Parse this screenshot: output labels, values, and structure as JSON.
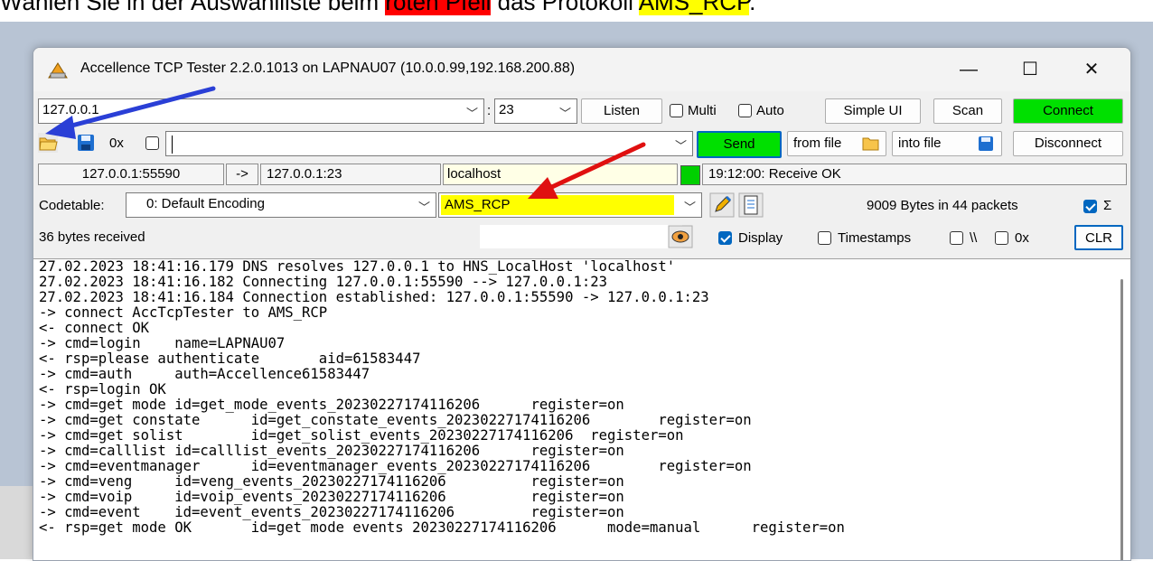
{
  "doc": {
    "prefix": "Wählen Sie in der Auswahlliste beim ",
    "highlight_red": "roten Pfeil",
    "middle": " das Protokoll ",
    "highlight_yellow": "AMS_RCP",
    "suffix": "."
  },
  "window": {
    "title": "Accellence TCP Tester 2.2.0.1013 on LAPNAU07 (10.0.0.99,192.168.200.88)",
    "minimize": "—",
    "maximize": "☐",
    "close": "✕"
  },
  "connection": {
    "host": "127.0.0.1",
    "port": "23",
    "listen": "Listen",
    "multi": "Multi",
    "multi_checked": false,
    "auto": "Auto",
    "auto_checked": false,
    "simple_ui": "Simple UI",
    "scan": "Scan",
    "connect": "Connect",
    "connect_color": "#00e000"
  },
  "send_row": {
    "hex_label": "0x",
    "hex_checked": false,
    "input_value": "",
    "send": "Send",
    "from_file": "from file",
    "into_file": "into file",
    "disconnect": "Disconnect"
  },
  "status": {
    "local": "127.0.0.1:55590",
    "arrow": "->",
    "remote": "127.0.0.1:23",
    "hostname": "localhost",
    "indicator_color": "#00d000",
    "message": "19:12:00: Receive OK"
  },
  "codetable": {
    "label": "Codetable:",
    "encoding": "0: Default Encoding",
    "protocol": "AMS_RCP",
    "bytes_info": "9009 Bytes in 44 packets",
    "sum_checked": true,
    "sum_symbol": "Σ"
  },
  "display_row": {
    "received": "36 bytes received",
    "display": "Display",
    "display_checked": true,
    "timestamps": "Timestamps",
    "timestamps_checked": false,
    "backslash": "\\\\",
    "backslash_checked": false,
    "hex": "0x",
    "hex_checked": false,
    "clr": "CLR"
  },
  "log": [
    "27.02.2023 18:41:16.179 DNS resolves 127.0.0.1 to HNS_LocalHost 'localhost'",
    "27.02.2023 18:41:16.182 Connecting 127.0.0.1:55590 --> 127.0.0.1:23",
    "27.02.2023 18:41:16.184 Connection established: 127.0.0.1:55590 -> 127.0.0.1:23",
    "-> connect AccTcpTester to AMS_RCP",
    "<- connect OK",
    "-> cmd=login    name=LAPNAU07",
    "<- rsp=please authenticate       aid=61583447",
    "-> cmd=auth     auth=Accellence61583447",
    "<- rsp=login OK",
    "-> cmd=get mode id=get_mode_events_20230227174116206      register=on",
    "-> cmd=get constate      id=get_constate_events_20230227174116206        register=on",
    "-> cmd=get solist        id=get_solist_events_20230227174116206  register=on",
    "-> cmd=calllist id=calllist_events_20230227174116206      register=on",
    "-> cmd=eventmanager      id=eventmanager_events_20230227174116206        register=on",
    "-> cmd=veng     id=veng_events_20230227174116206          register=on",
    "-> cmd=voip     id=voip_events_20230227174116206          register=on",
    "-> cmd=event    id=event_events_20230227174116206         register=on",
    "<- rsp=get mode OK       id=get mode events 20230227174116206      mode=manual      register=on"
  ]
}
